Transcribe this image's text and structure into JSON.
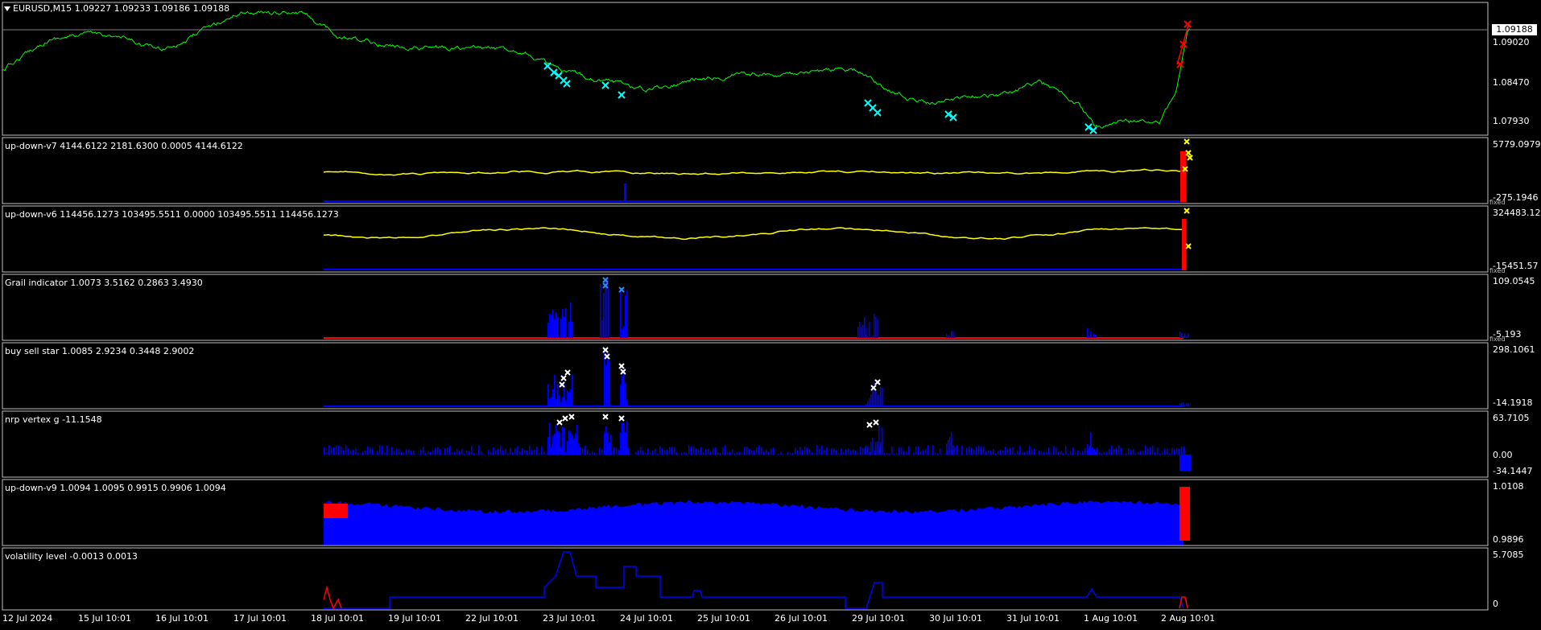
{
  "main": {
    "label": "EURUSD,M15  1.09227 1.09233 1.09186 1.09188",
    "current_price": "1.09188",
    "scale": [
      "1.09020",
      "1.08470",
      "1.07930"
    ]
  },
  "panes": [
    {
      "id": "up-down-v7",
      "label": "up-down-v7 4144.6122 2181.6300 0.0005 4144.6122",
      "scale_top": "5779.0979",
      "scale_bottom": "-275.1946",
      "has_mini": true
    },
    {
      "id": "up-down-v6",
      "label": "up-down-v6 114456.1273 103495.5511 0.0000 103495.5511 114456.1273",
      "scale_top": "324483.12",
      "scale_bottom": "-15451.57",
      "has_mini": true
    },
    {
      "id": "grail",
      "label": "Grail indicator 1.0073 3.5162 0.2863 3.4930",
      "scale_top": "109.0545",
      "scale_bottom": "-5.193",
      "has_mini": true
    },
    {
      "id": "buy-sell-star",
      "label": "buy sell star 1.0085 2.9234 0.3448 2.9002",
      "scale_top": "298.1061",
      "scale_bottom": "-14.1918",
      "has_mini": false
    },
    {
      "id": "nrp-vertex",
      "label": "nrp vertex g -11.1548",
      "scale_top": "63.7105",
      "scale_mid": "0.00",
      "scale_bottom": "-34.1447",
      "has_mini": false
    },
    {
      "id": "up-down-v9",
      "label": "up-down-v9 1.0094 1.0095 0.9915 0.9906 1.0094",
      "scale_top": "1.0108",
      "scale_bottom": "0.9896",
      "has_mini": false
    },
    {
      "id": "volatility",
      "label": "volatility level -0.0013 0.0013",
      "scale_top": "5.7085",
      "scale_bottom": "0",
      "has_mini": false
    }
  ],
  "mini_label": "fixed",
  "dates": [
    "12 Jul 2024",
    "15 Jul 10:01",
    "16 Jul 10:01",
    "17 Jul 10:01",
    "18 Jul 10:01",
    "19 Jul 10:01",
    "22 Jul 10:01",
    "23 Jul 10:01",
    "24 Jul 10:01",
    "25 Jul 10:01",
    "26 Jul 10:01",
    "29 Jul 10:01",
    "30 Jul 10:01",
    "31 Jul 10:01",
    "1 Aug 10:01",
    "2 Aug 10:01"
  ],
  "colors": {
    "background": "#000000",
    "grid_border": "#c0c0c0",
    "price_line": "#00ff00",
    "indicator_yellow": "#ffff00",
    "histogram_blue": "#0000ff",
    "histogram_red": "#ff0000",
    "marker_cyan": "#00ffff",
    "marker_white": "#ffffff",
    "marker_orange": "#ffa500"
  }
}
